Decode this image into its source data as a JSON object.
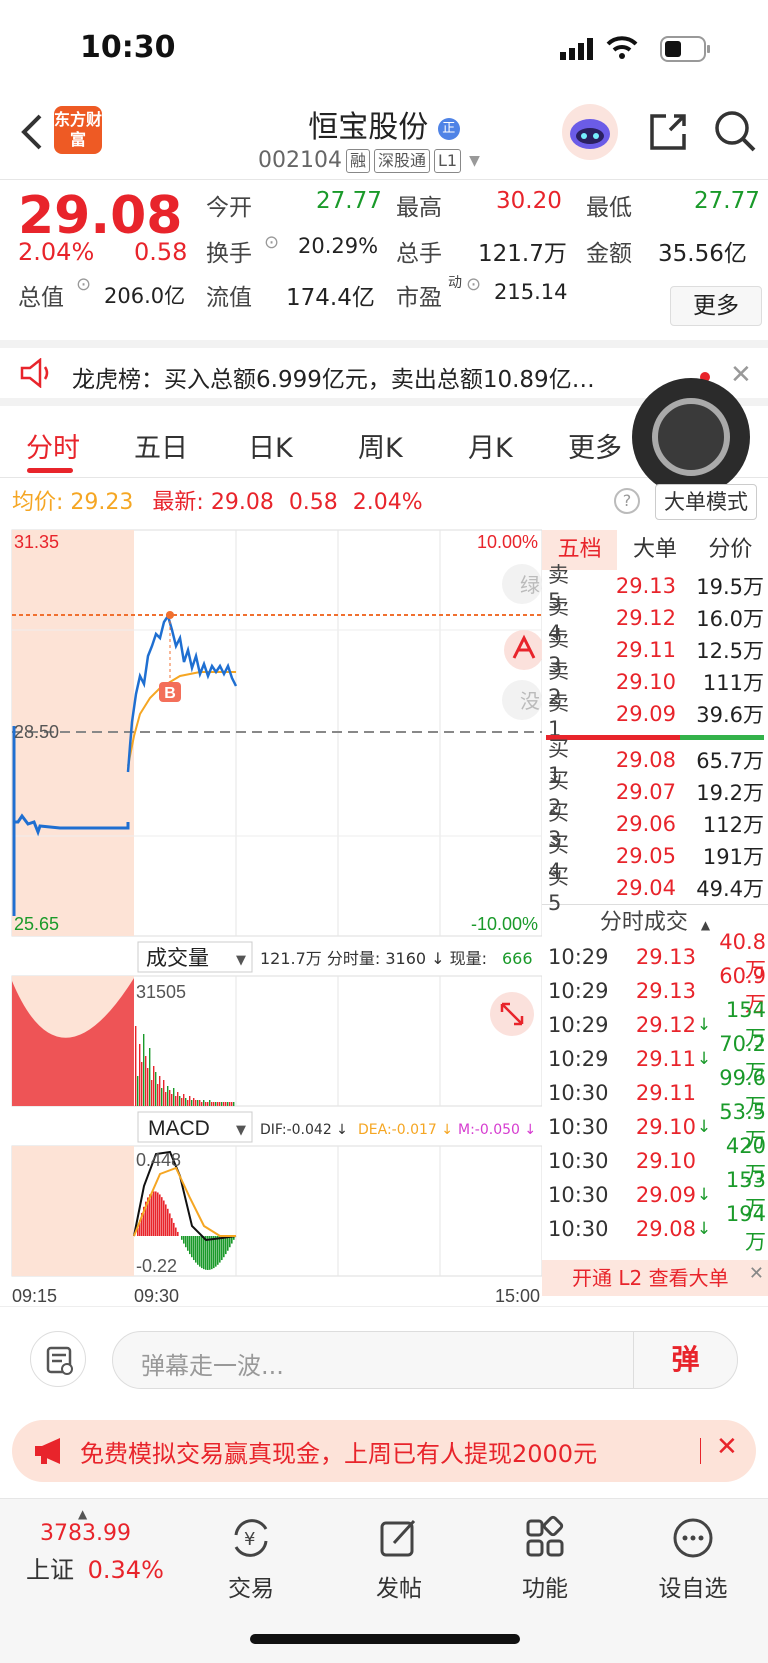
{
  "status_bar": {
    "time": "10:30"
  },
  "nav": {
    "app_logo": "东方财富",
    "stock_name": "恒宝股份",
    "badge": "正",
    "code": "002104",
    "tags": [
      "融",
      "深股通",
      "L1"
    ]
  },
  "quote": {
    "last_price": "29.08",
    "change_pct": "2.04%",
    "change": "0.58",
    "open_label": "今开",
    "open": "27.77",
    "high_label": "最高",
    "high": "30.20",
    "low_label": "最低",
    "low": "27.77",
    "turnover_label": "换手",
    "turnover": "20.29%",
    "volume_label": "总手",
    "volume": "121.7万",
    "amount_label": "金额",
    "amount": "35.56亿",
    "mktcap_label": "总值",
    "mktcap": "206.0亿",
    "float_label": "流值",
    "float_cap": "174.4亿",
    "pe_label": "市盈",
    "pe_sup": "动",
    "pe": "215.14",
    "more_label": "更多"
  },
  "notice": {
    "text": "龙虎榜：买入总额6.999亿元，卖出总额10.89亿…"
  },
  "tabs": [
    "分时",
    "五日",
    "日K",
    "周K",
    "月K",
    "更多"
  ],
  "info_line": {
    "avg_label": "均价:",
    "avg": "29.23",
    "latest_label": "最新:",
    "latest": "29.08",
    "chg": "0.58",
    "pct": "2.04%",
    "bigorder_mode": "大单模式"
  },
  "price_chart": {
    "y_max": "31.35",
    "y_mid": "28.50",
    "y_min": "25.65",
    "pct_max": "10.00%",
    "pct_min": "-10.00%",
    "side_labels": [
      "绿",
      "没"
    ],
    "buy_marker": "B"
  },
  "volume_panel": {
    "indicator": "成交量",
    "stats": "121.7万 分时量: 3160 ↓ 现量:",
    "current": "666",
    "peak": "31505"
  },
  "macd_panel": {
    "indicator": "MACD",
    "dif": "DIF:-0.042 ↓",
    "dea": "DEA:-0.017 ↓",
    "m": "M:-0.050 ↓",
    "top": "0.448",
    "bottom": "-0.22"
  },
  "time_axis": [
    "09:15",
    "09:30",
    "15:00"
  ],
  "orderbook": {
    "tabs": [
      "五档",
      "大单",
      "分价"
    ],
    "asks": [
      {
        "label": "卖5",
        "price": "29.13",
        "vol": "19.5万"
      },
      {
        "label": "卖4",
        "price": "29.12",
        "vol": "16.0万"
      },
      {
        "label": "卖3",
        "price": "29.11",
        "vol": "12.5万"
      },
      {
        "label": "卖2",
        "price": "29.10",
        "vol": "111万"
      },
      {
        "label": "卖1",
        "price": "29.09",
        "vol": "39.6万"
      }
    ],
    "bids": [
      {
        "label": "买1",
        "price": "29.08",
        "vol": "65.7万"
      },
      {
        "label": "买2",
        "price": "29.07",
        "vol": "19.2万"
      },
      {
        "label": "买3",
        "price": "29.06",
        "vol": "112万"
      },
      {
        "label": "买4",
        "price": "29.05",
        "vol": "191万"
      },
      {
        "label": "买5",
        "price": "29.04",
        "vol": "49.4万"
      }
    ],
    "ticks_title": "分时成交",
    "ticks": [
      {
        "time": "10:29",
        "price": "29.13",
        "arrow": "",
        "vol": "40.8万",
        "color": "#e8242b"
      },
      {
        "time": "10:29",
        "price": "29.13",
        "arrow": "",
        "vol": "60.9万",
        "color": "#e8242b"
      },
      {
        "time": "10:29",
        "price": "29.12",
        "arrow": "↓",
        "vol": "154万",
        "color": "#1a9a2a"
      },
      {
        "time": "10:29",
        "price": "29.11",
        "arrow": "↓",
        "vol": "70.2万",
        "color": "#1a9a2a"
      },
      {
        "time": "10:30",
        "price": "29.11",
        "arrow": "",
        "vol": "99.6万",
        "color": "#1a9a2a"
      },
      {
        "time": "10:30",
        "price": "29.10",
        "arrow": "↓",
        "vol": "53.5万",
        "color": "#1a9a2a"
      },
      {
        "time": "10:30",
        "price": "29.10",
        "arrow": "",
        "vol": "420万",
        "color": "#1a9a2a"
      },
      {
        "time": "10:30",
        "price": "29.09",
        "arrow": "↓",
        "vol": "153万",
        "color": "#1a9a2a"
      },
      {
        "time": "10:30",
        "price": "29.08",
        "arrow": "↓",
        "vol": "194万",
        "color": "#1a9a2a"
      }
    ],
    "l2_text": "开通 L2 查看大单"
  },
  "comment": {
    "placeholder": "弹幕走一波...",
    "danmu_label": "弹"
  },
  "promo": {
    "text": "免费模拟交易赢真现金，上周已有人提现2000元"
  },
  "bottom_nav": {
    "index_value": "3783.99",
    "index_name": "上证",
    "index_pct": "0.34%",
    "items": [
      "交易",
      "发帖",
      "功能",
      "设自选"
    ]
  },
  "colors": {
    "up": "#e8242b",
    "down": "#1a9a2a",
    "price_line": "#1f6fd1",
    "avg_line": "#f5a623"
  }
}
